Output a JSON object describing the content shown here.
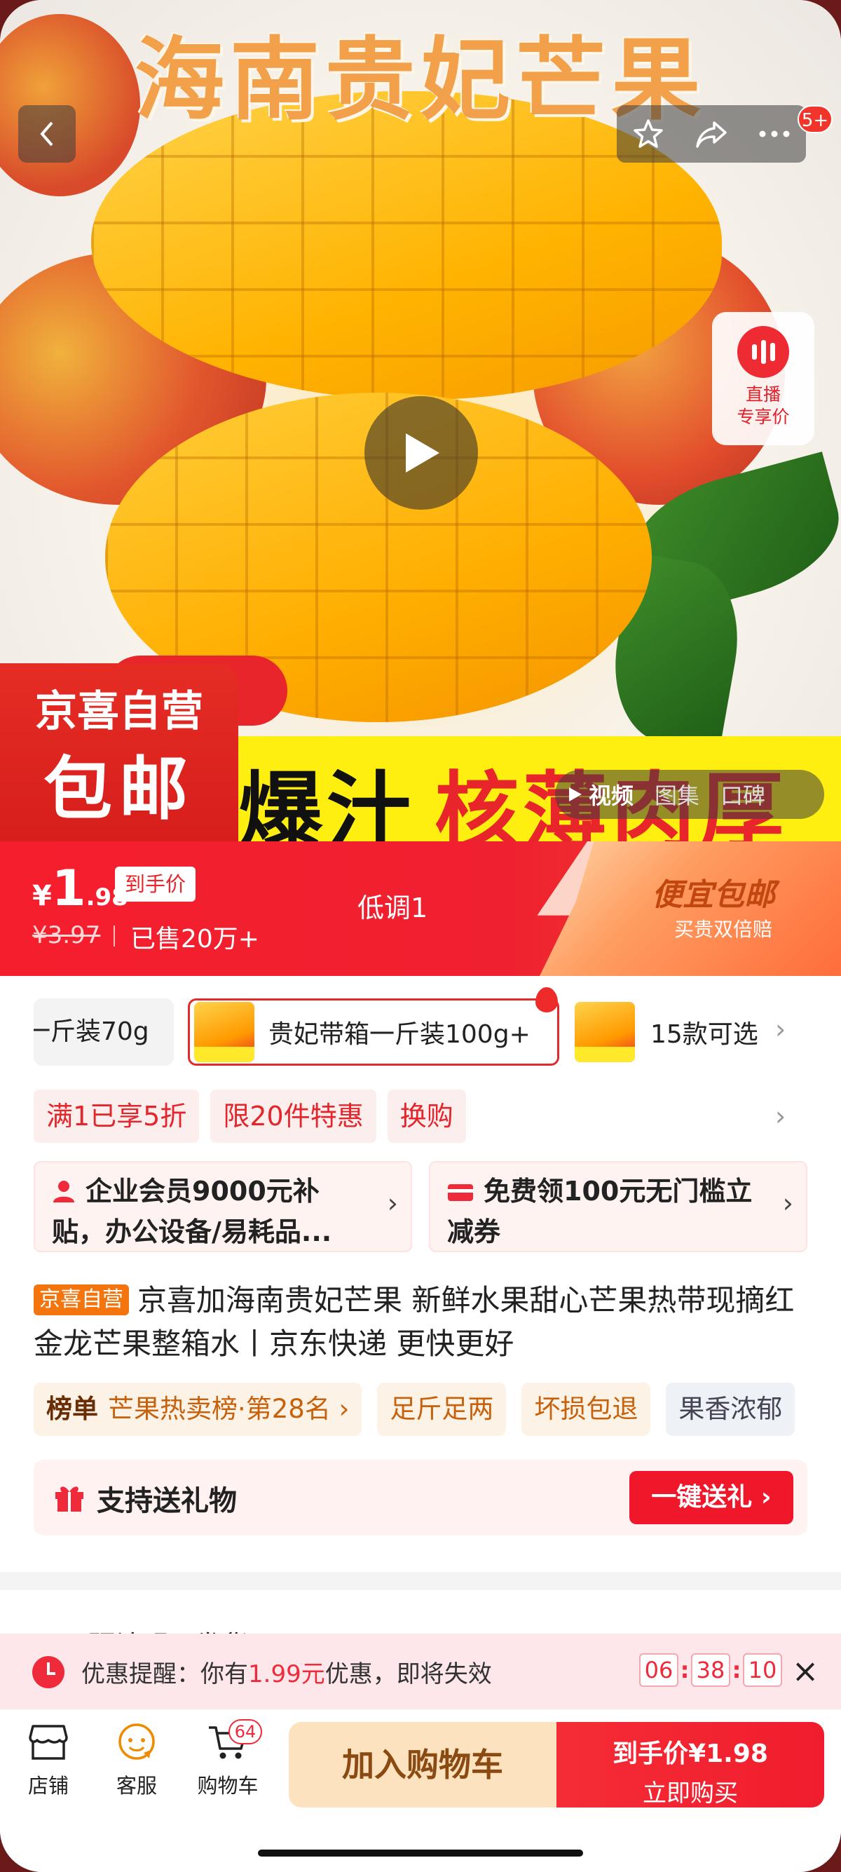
{
  "hero": {
    "title": "海南贵妃芒果",
    "promo_left": "爆汁",
    "promo_right": "核薄肉厚",
    "badge_line1": "京喜自营",
    "badge_line2": "包邮",
    "message_badge": "5+",
    "live": {
      "line1": "直播",
      "line2": "专享价"
    },
    "media_tabs": [
      "视频",
      "图集",
      "口碑"
    ]
  },
  "price": {
    "currency": "¥",
    "integer": "1",
    "decimal": ".98",
    "tag": "到手价",
    "original": "¥3.97",
    "sold": "已售20万+",
    "note": "低调1",
    "promo_title": "便宜包邮",
    "promo_sub": "买贵双倍赔"
  },
  "variants": {
    "items": [
      "一斤装70g",
      "贵妃带箱一斤装100g+"
    ],
    "more": "15款可选"
  },
  "coupons": [
    "满1已享5折",
    "限20件特惠",
    "换购"
  ],
  "cards": [
    {
      "icon": "user-icon",
      "text": "企业会员9000元补贴，办公设备/易耗品..."
    },
    {
      "icon": "card-icon",
      "text": "免费领100元无门槛立减券"
    }
  ],
  "product": {
    "badge": "京喜自营",
    "title": "京喜加海南贵妃芒果 新鲜水果甜心芒果热带现摘红金龙芒果整箱水丨京东快递 更快更好"
  },
  "tags": {
    "rank_label": "榜单",
    "rank_value": "芒果热卖榜·第28名",
    "chips": [
      "足斤足两",
      "坏损包退",
      "果香浓郁"
    ]
  },
  "gift": {
    "text": "支持送礼物",
    "button": "一键送礼"
  },
  "shipping": {
    "text": "预计明天发货"
  },
  "reminder": {
    "prefix": "优惠提醒：你有",
    "amount": "1.99元",
    "suffix": "优惠，即将失效",
    "hh": "06",
    "mm": "38",
    "ss": "10"
  },
  "bottom": {
    "store": "店铺",
    "service": "客服",
    "cart": "购物车",
    "cart_count": "64",
    "add_to_cart": "加入购物车",
    "buy_line1": "到手价¥1.98",
    "buy_line2": "立即购买"
  },
  "colors": {
    "accent_red": "#f01d2d",
    "orange_badge": "#f4740e",
    "promo_yellow": "#ffef10"
  }
}
